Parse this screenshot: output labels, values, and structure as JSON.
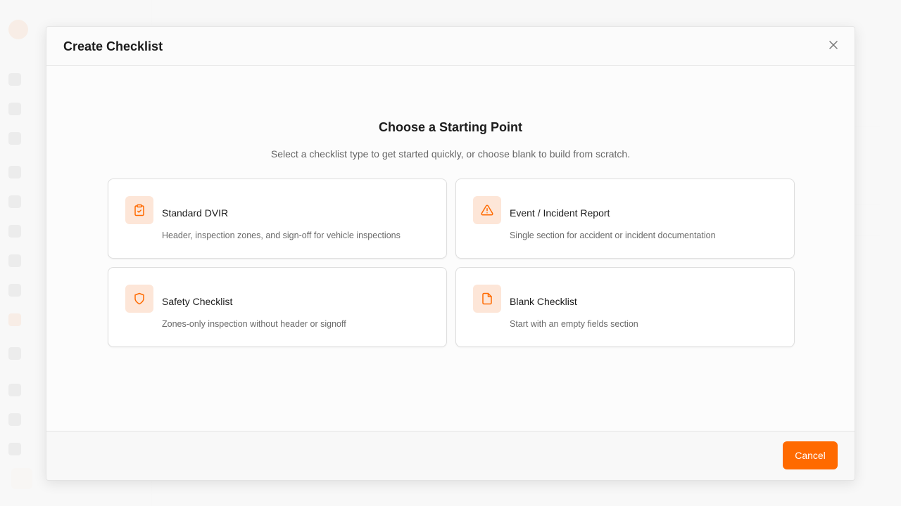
{
  "modal": {
    "title": "Create Checklist",
    "heading": "Choose a Starting Point",
    "subheading": "Select a checklist type to get started quickly, or choose blank to build from scratch.",
    "options": [
      {
        "icon": "clipboard-check-icon",
        "title": "Standard DVIR",
        "description": "Header, inspection zones, and sign-off for vehicle inspections"
      },
      {
        "icon": "warning-triangle-icon",
        "title": "Event / Incident Report",
        "description": "Single section for accident or incident documentation"
      },
      {
        "icon": "shield-icon",
        "title": "Safety Checklist",
        "description": "Zones-only inspection without header or signoff"
      },
      {
        "icon": "document-icon",
        "title": "Blank Checklist",
        "description": "Start with an empty fields section"
      }
    ],
    "cancel_label": "Cancel"
  },
  "colors": {
    "accent": "#ff6a00",
    "icon_bg": "#fde6d8",
    "text_primary": "#1c1c1c",
    "text_secondary": "#6a6a6a"
  }
}
